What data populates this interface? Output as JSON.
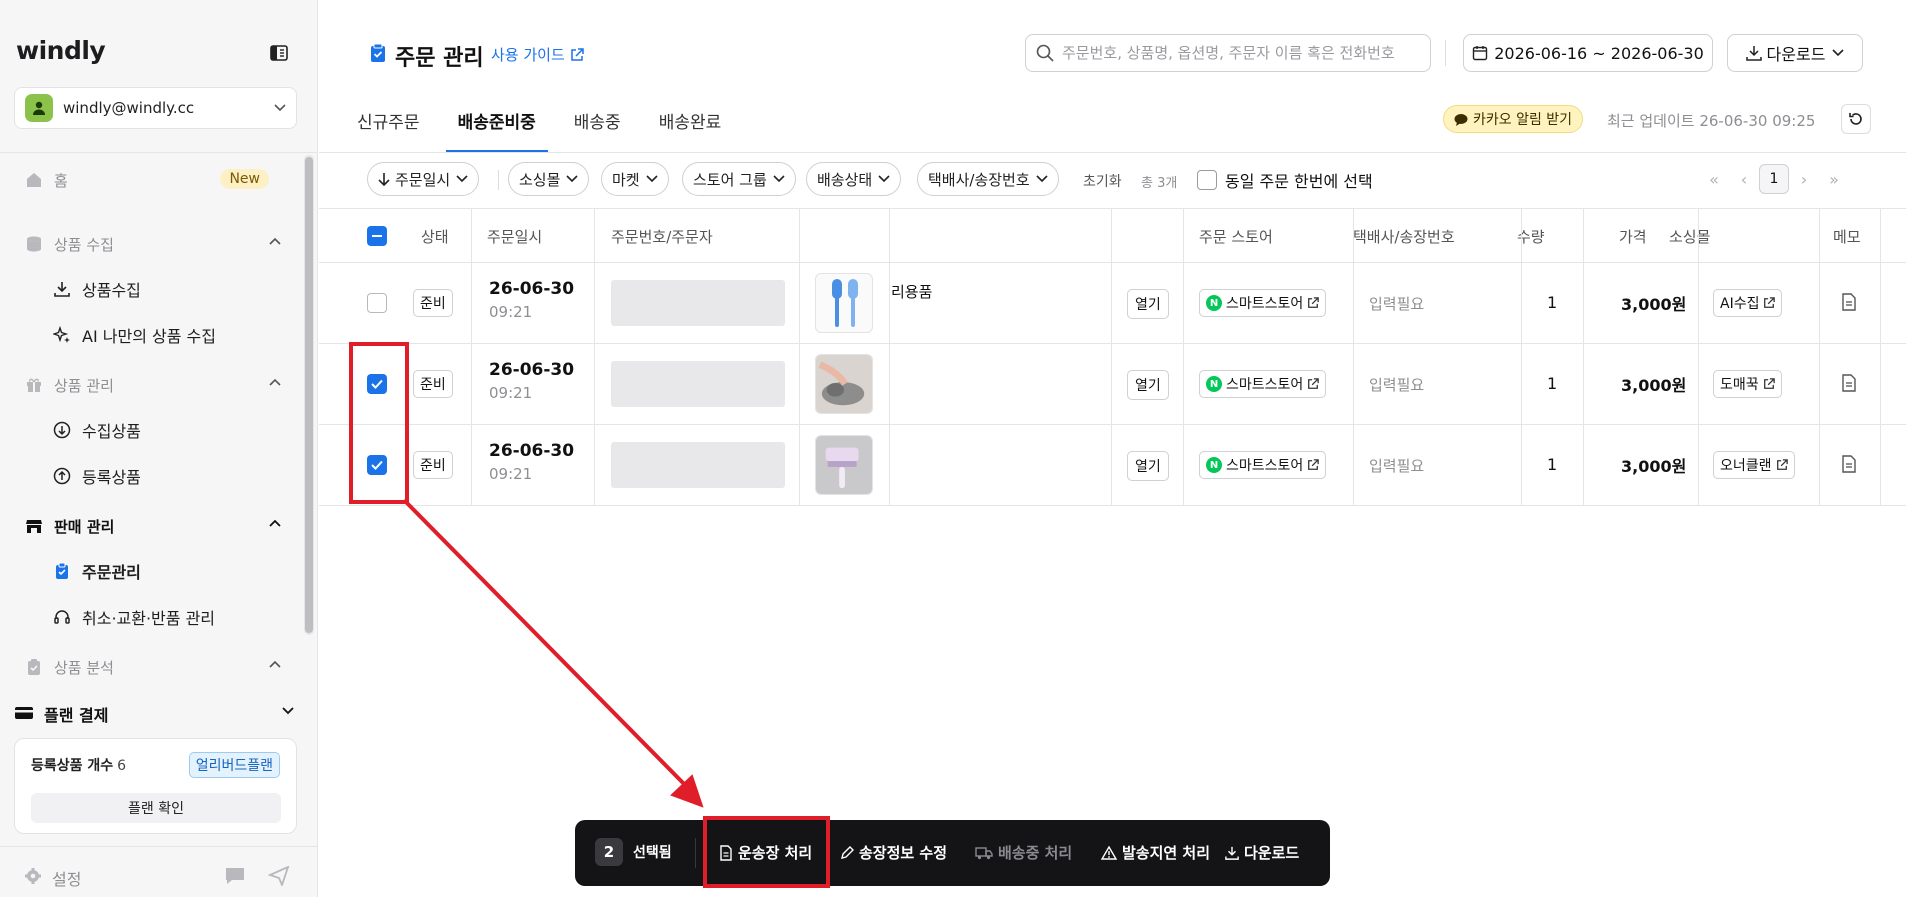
{
  "app": {
    "logo": "windly",
    "account_email": "windly@windly.cc"
  },
  "sidebar": {
    "home": {
      "label": "홈",
      "badge": "New"
    },
    "sections": [
      {
        "label": "상품 수집",
        "items": [
          {
            "label": "상품수집"
          },
          {
            "label": "AI 나만의 상품 수집"
          }
        ]
      },
      {
        "label": "상품 관리",
        "items": [
          {
            "label": "수집상품"
          },
          {
            "label": "등록상품"
          }
        ]
      },
      {
        "label": "판매 관리",
        "items": [
          {
            "label": "주문관리"
          },
          {
            "label": "취소·교환·반품 관리"
          }
        ]
      },
      {
        "label": "상품 분석",
        "items": []
      }
    ],
    "plan": {
      "header": "플랜 결제",
      "count_label": "등록상품 개수",
      "count_value": "6",
      "badge": "얼리버드플랜",
      "button": "플랜 확인"
    },
    "settings": "설정"
  },
  "header": {
    "title": "주문 관리",
    "guide_link": "사용 가이드",
    "search_placeholder": "주문번호, 상품명, 옵션명, 주문자 이름 혹은 전화번호",
    "date_range": "2026-06-16 ~ 2026-06-30",
    "download": "다운로드"
  },
  "tabs": [
    {
      "label": "신규주문"
    },
    {
      "label": "배송준비중"
    },
    {
      "label": "배송중"
    },
    {
      "label": "배송완료"
    }
  ],
  "notify": {
    "kakao": "카카오 알림 받기",
    "updated": "최근 업데이트 26-06-30 09:25"
  },
  "filters": {
    "sort": "주문일시",
    "chips": [
      "소싱몰",
      "마켓",
      "스토어 그룹",
      "배송상태",
      "택배사/송장번호"
    ],
    "reset": "초기화",
    "total": "총 3개",
    "same_order": "동일 주문 한번에 선택",
    "page": "1"
  },
  "table": {
    "columns": {
      "status": "상태",
      "date": "주문일시",
      "order": "주문번호/주문자",
      "store": "주문 스토어",
      "courier": "택배사/송장번호",
      "qty": "수량",
      "price": "가격",
      "source": "소싱몰",
      "memo": "메모"
    },
    "rows": [
      {
        "checked": false,
        "status": "준비",
        "date": "26-06-30",
        "time": "09:21",
        "product": "리용품",
        "open": "열기",
        "store": "스마트스토어",
        "courier": "입력필요",
        "qty": "1",
        "price": "3,000원",
        "source": "AI수집"
      },
      {
        "checked": true,
        "status": "준비",
        "date": "26-06-30",
        "time": "09:21",
        "product": "",
        "open": "열기",
        "store": "스마트스토어",
        "courier": "입력필요",
        "qty": "1",
        "price": "3,000원",
        "source": "도매꾹"
      },
      {
        "checked": true,
        "status": "준비",
        "date": "26-06-30",
        "time": "09:21",
        "product": "",
        "open": "열기",
        "store": "스마트스토어",
        "courier": "입력필요",
        "qty": "1",
        "price": "3,000원",
        "source": "오너클랜"
      }
    ]
  },
  "action_bar": {
    "selected_count": "2",
    "selected_label": "선택됨",
    "actions": [
      {
        "label": "운송장 처리"
      },
      {
        "label": "송장정보 수정"
      },
      {
        "label": "배송중 처리"
      },
      {
        "label": "발송지연 처리"
      },
      {
        "label": "다운로드"
      }
    ]
  },
  "colors": {
    "accent": "#1a73e8",
    "highlight": "#e01e2a",
    "naver": "#03c75a"
  }
}
